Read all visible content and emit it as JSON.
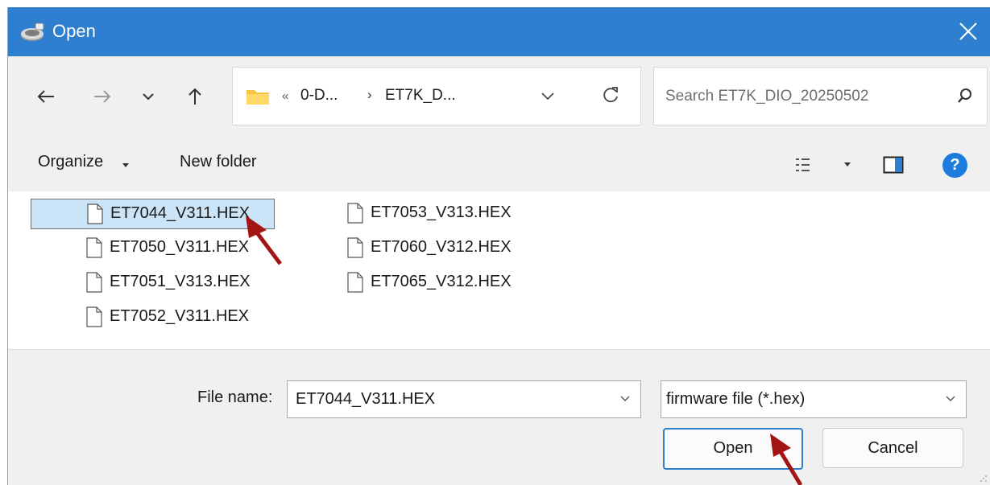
{
  "window": {
    "title": "Open"
  },
  "navigation": {
    "breadcrumb_overflow": "«",
    "crumbs": [
      "0-D...",
      "ET7K_D..."
    ],
    "crumb_separator": "›"
  },
  "search": {
    "placeholder": "Search ET7K_DIO_20250502"
  },
  "toolbar": {
    "organize_label": "Organize",
    "new_folder_label": "New folder"
  },
  "files": [
    {
      "name": "ET7044_V311.HEX",
      "selected": true
    },
    {
      "name": "ET7050_V311.HEX",
      "selected": false
    },
    {
      "name": "ET7051_V313.HEX",
      "selected": false
    },
    {
      "name": "ET7052_V311.HEX",
      "selected": false
    },
    {
      "name": "ET7053_V313.HEX",
      "selected": false
    },
    {
      "name": "ET7060_V312.HEX",
      "selected": false
    },
    {
      "name": "ET7065_V312.HEX",
      "selected": false
    }
  ],
  "bottom": {
    "file_name_label": "File name:",
    "file_name_value": "ET7044_V311.HEX",
    "file_type_value": "firmware file (*.hex)",
    "open_label": "Open",
    "cancel_label": "Cancel"
  },
  "colors": {
    "titlebar": "#2f7fd0",
    "selection": "#cce4f7",
    "annotation_arrow": "#a31515",
    "help": "#1e7ddc"
  },
  "help": {
    "glyph": "?"
  }
}
